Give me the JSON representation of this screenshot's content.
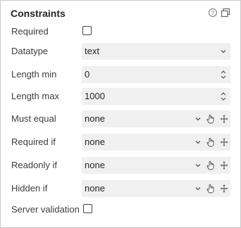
{
  "panel": {
    "title": "Constraints",
    "icons": {
      "help": "help-circle-icon",
      "window": "windows-icon"
    }
  },
  "fields": {
    "required": {
      "label": "Required",
      "checked": false
    },
    "datatype": {
      "label": "Datatype",
      "value": "text"
    },
    "length_min": {
      "label": "Length min",
      "value": "0"
    },
    "length_max": {
      "label": "Length max",
      "value": "1000"
    },
    "must_equal": {
      "label": "Must equal",
      "value": "none"
    },
    "required_if": {
      "label": "Required if",
      "value": "none"
    },
    "readonly_if": {
      "label": "Readonly if",
      "value": "none"
    },
    "hidden_if": {
      "label": "Hidden if",
      "value": "none"
    },
    "server_validation": {
      "label": "Server validation",
      "checked": false
    }
  },
  "icons": {
    "dropdown": "chevron-down-icon",
    "spinner": "up-down-stepper-icon",
    "pick": "hand-pointer-icon",
    "move": "move-arrows-icon"
  }
}
